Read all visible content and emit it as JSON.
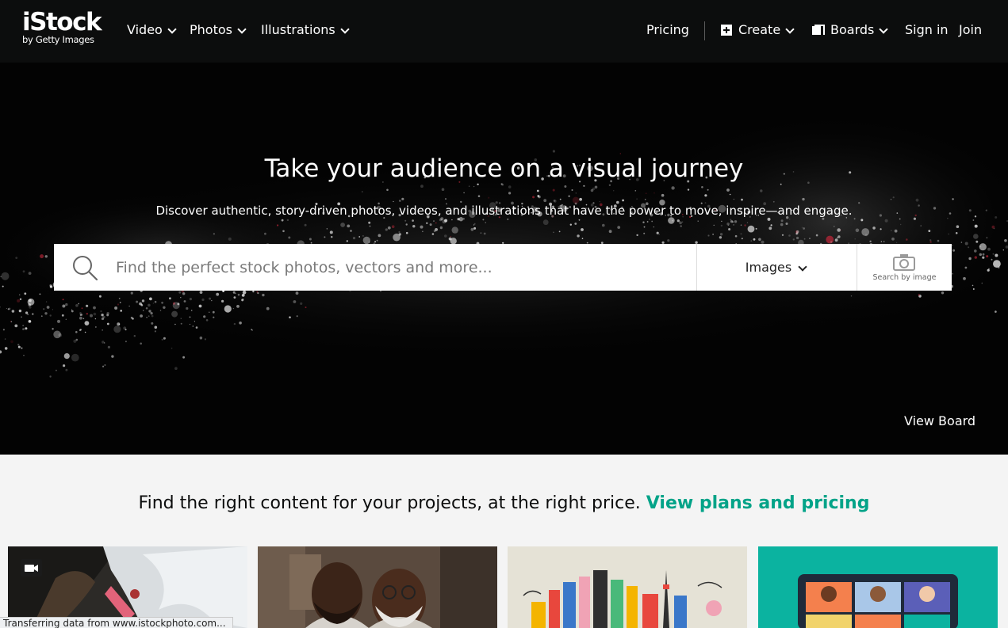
{
  "header": {
    "logo": {
      "brand": "iStock",
      "byline": "by Getty Images"
    },
    "left_nav": [
      {
        "label": "Video"
      },
      {
        "label": "Photos"
      },
      {
        "label": "Illustrations"
      }
    ],
    "right_nav": {
      "pricing": "Pricing",
      "create": "Create",
      "boards": "Boards",
      "sign_in": "Sign in",
      "join": "Join"
    }
  },
  "hero": {
    "title": "Take your audience on a visual journey",
    "subtitle": "Discover authentic, story-driven photos, videos, and illustrations that have the power to move, inspire—and engage.",
    "view_board": "View Board"
  },
  "search": {
    "placeholder": "Find the perfect stock photos, vectors and more...",
    "value": "",
    "type_selected": "Images",
    "search_by_image": "Search by image"
  },
  "pricing": {
    "text": "Find the right content for your projects, at the right price.",
    "link": "View plans and pricing"
  },
  "cards": [
    {
      "name": "kayaker-waterfall-video",
      "has_video_icon": true
    },
    {
      "name": "two-men-portrait"
    },
    {
      "name": "city-illustration"
    },
    {
      "name": "video-call-illustration"
    }
  ],
  "status_bar": "Transferring data from www.istockphoto.com...",
  "colors": {
    "nav_bg": "#0c0d0d",
    "accent_green": "#02a388",
    "page_bg": "#f4f4f4",
    "teal_card": "#0bb3a0"
  },
  "icons": [
    "chevron-down-icon",
    "create-plus-icon",
    "boards-icon",
    "search-icon",
    "camera-icon",
    "video-camera-icon"
  ]
}
